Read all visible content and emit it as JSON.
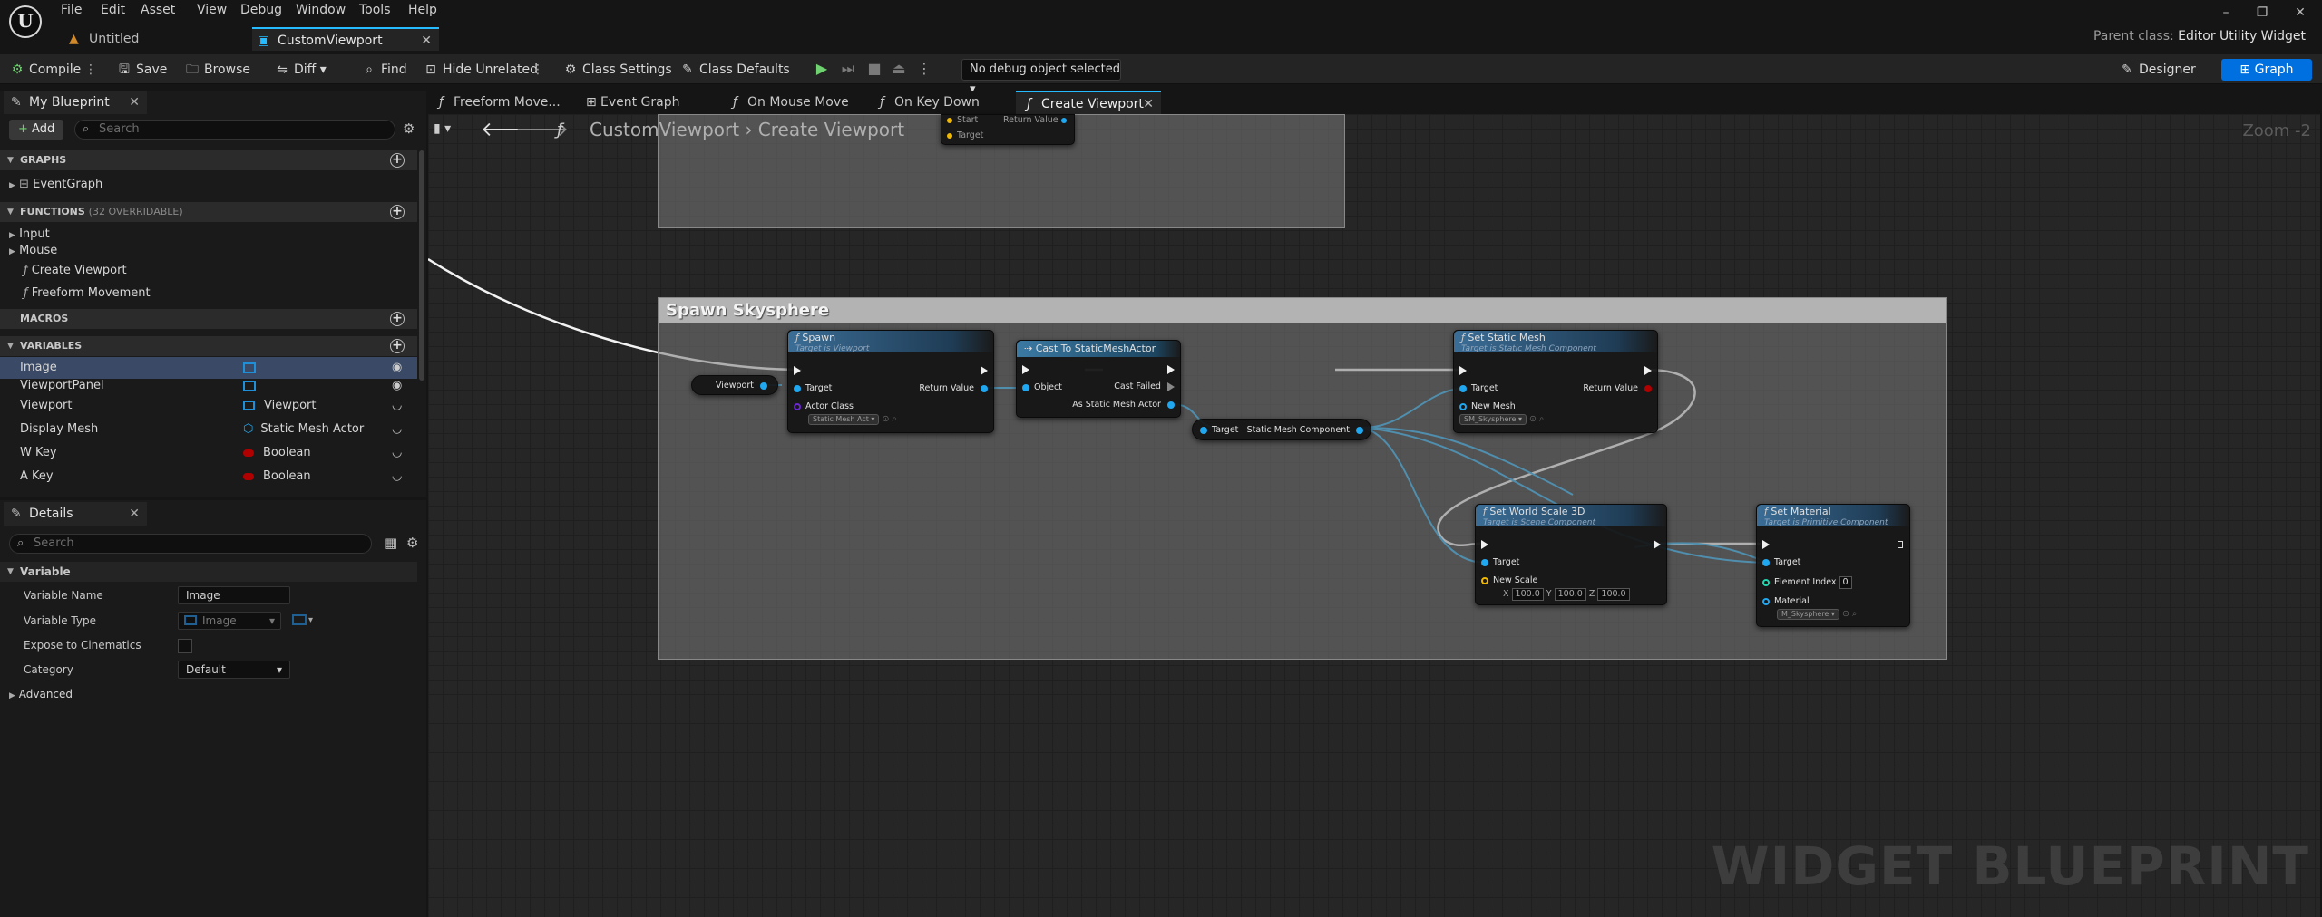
{
  "menu": [
    "File",
    "Edit",
    "Asset",
    "View",
    "Debug",
    "Window",
    "Tools",
    "Help"
  ],
  "parent_class": {
    "label": "Parent class:",
    "value": "Editor Utility Widget"
  },
  "doc_tabs": [
    {
      "label": "Untitled"
    },
    {
      "label": "CustomViewport"
    }
  ],
  "toolbar": {
    "compile": "Compile",
    "save": "Save",
    "browse": "Browse",
    "diff": "Diff",
    "find": "Find",
    "hide_unrelated": "Hide Unrelated",
    "class_settings": "Class Settings",
    "class_defaults": "Class Defaults",
    "debug_object": "No debug object selected",
    "designer": "Designer",
    "graph": "Graph"
  },
  "my_blueprint": {
    "tab": "My Blueprint",
    "add": "Add",
    "search_placeholder": "Search",
    "graphs_header": "GRAPHS",
    "graphs": [
      "EventGraph"
    ],
    "functions_header": "FUNCTIONS",
    "functions_overridable": "(32 OVERRIDABLE)",
    "function_groups": [
      "Input",
      "Mouse"
    ],
    "functions": [
      "Create Viewport",
      "Freeform Movement"
    ],
    "macros_header": "MACROS",
    "variables_header": "VARIABLES",
    "variables": [
      {
        "name": "Image",
        "type": ""
      },
      {
        "name": "ViewportPanel",
        "type": ""
      },
      {
        "name": "Viewport",
        "type": "Viewport"
      },
      {
        "name": "Display Mesh",
        "type": "Static Mesh Actor"
      },
      {
        "name": "W Key",
        "type": "Boolean"
      },
      {
        "name": "A Key",
        "type": "Boolean"
      }
    ]
  },
  "details": {
    "tab": "Details",
    "search_placeholder": "Search",
    "section": "Variable",
    "props": [
      {
        "label": "Variable Name",
        "value": "Image"
      },
      {
        "label": "Variable Type",
        "value": "Image"
      },
      {
        "label": "Expose to Cinematics",
        "value": ""
      },
      {
        "label": "Category",
        "value": "Default"
      }
    ],
    "advanced": "Advanced"
  },
  "graph_tabs": [
    "Freeform Move...",
    "Event Graph",
    "On Mouse Move",
    "On Key Down",
    "Create Viewport"
  ],
  "breadcrumb": {
    "root": "CustomViewport",
    "current": "Create Viewport"
  },
  "zoom": "Zoom -2",
  "watermark": "WIDGET BLUEPRINT",
  "graph": {
    "top_node": {
      "pin1": "Start",
      "pin2": "Target",
      "out": "Return Value"
    },
    "comment_title": "Spawn Skysphere",
    "viewport_var": "Viewport",
    "spawn": {
      "title": "Spawn",
      "subtitle": "Target is Viewport",
      "target": "Target",
      "actor_class": "Actor Class",
      "actor_class_value": "Static Mesh Act",
      "return_value": "Return Value"
    },
    "cast": {
      "title": "Cast To StaticMeshActor",
      "object": "Object",
      "cast_failed": "Cast Failed",
      "as_value": "As Static Mesh Actor"
    },
    "getter": {
      "target": "Target",
      "out": "Static Mesh Component"
    },
    "set_static_mesh": {
      "title": "Set Static Mesh",
      "subtitle": "Target is Static Mesh Component",
      "target": "Target",
      "new_mesh": "New Mesh",
      "new_mesh_value": "SM_Skysphere",
      "return_value": "Return Value"
    },
    "set_world_scale": {
      "title": "Set World Scale 3D",
      "subtitle": "Target is Scene Component",
      "target": "Target",
      "new_scale": "New Scale",
      "x_label": "X",
      "y_label": "Y",
      "z_label": "Z",
      "x": "100.0",
      "y": "100.0",
      "z": "100.0"
    },
    "set_material": {
      "title": "Set Material",
      "subtitle": "Target is Primitive Component",
      "target": "Target",
      "element_index": "Element Index",
      "element_index_value": "0",
      "material": "Material",
      "material_value": "M_Skysphere"
    }
  },
  "colors": {
    "accent": "#0070e0",
    "object_pin": "#1fa8f0",
    "boolean": "#b00000",
    "struct": "#f0b800",
    "class": "#6a2ad0"
  }
}
